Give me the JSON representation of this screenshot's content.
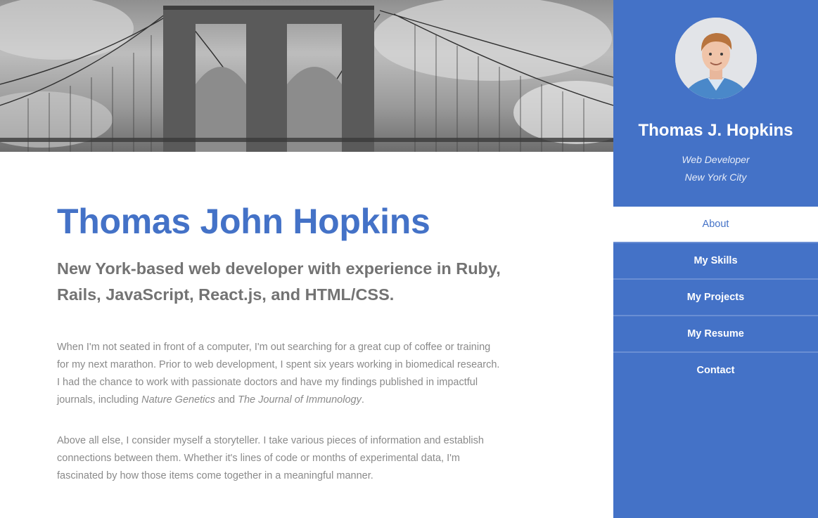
{
  "hero": {
    "icon": "bridge-photo"
  },
  "main": {
    "title": "Thomas John Hopkins",
    "tagline": "New York-based web developer with experience in Ruby, Rails, JavaScript, React.js, and HTML/CSS.",
    "para1": {
      "before": "When I'm not seated in front of a computer, I'm out searching for a great cup of coffee or training for my next marathon. Prior to web development, I spent six years working in biomedical research. I had the chance to work with passionate doctors and have my findings published in impactful journals, including ",
      "italic1": "Nature Genetics",
      "middle": " and ",
      "italic2": "The Journal of Immunology",
      "after": "."
    },
    "para2": "Above all else, I consider myself a storyteller. I take various pieces of information and establish connections between them. Whether it's lines of code or months of experimental data, I'm fascinated by how those items come together in a meaningful manner."
  },
  "sidebar": {
    "name": "Thomas J. Hopkins",
    "role": "Web Developer",
    "city": "New York City",
    "nav": [
      {
        "label": "About",
        "active": true
      },
      {
        "label": "My Skills"
      },
      {
        "label": "My Projects"
      },
      {
        "label": "My Resume"
      },
      {
        "label": "Contact"
      }
    ]
  },
  "colors": {
    "accent": "#4472c7",
    "text_gray": "#737373",
    "body_gray": "#8a8a8a"
  }
}
